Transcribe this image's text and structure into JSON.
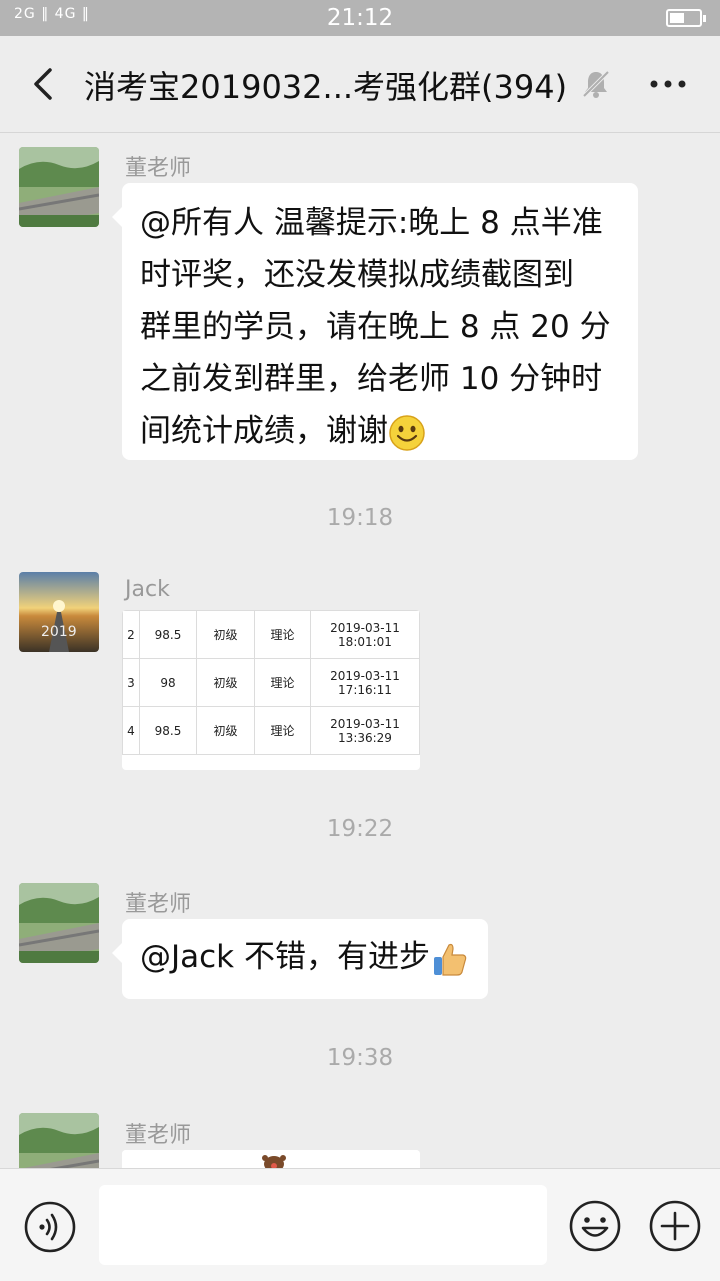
{
  "status": {
    "signal": "2G ‖ 4G ‖",
    "time": "21:12"
  },
  "header": {
    "title": "消考宝2019032...考强化群(394)"
  },
  "messages": [
    {
      "sender": "董老师",
      "text_lines": [
        "@所有人  温馨提示:晚上 8 点半准",
        "时评奖，还没发模拟成绩截图到",
        "群里的学员，请在晚上 8 点 20 分",
        "之前发到群里，给老师 10 分钟时",
        "间统计成绩，谢谢"
      ]
    },
    {
      "time": "19:18"
    },
    {
      "sender": "Jack",
      "table": [
        [
          "2",
          "98.5",
          "初级",
          "理论",
          "2019-03-11",
          "18:01:01"
        ],
        [
          "3",
          "98",
          "初级",
          "理论",
          "2019-03-11",
          "17:16:11"
        ],
        [
          "4",
          "98.5",
          "初级",
          "理论",
          "2019-03-11",
          "13:36:29"
        ]
      ]
    },
    {
      "time": "19:22"
    },
    {
      "sender": "董老师",
      "text": "@Jack  不错，有进步"
    },
    {
      "time": "19:38"
    },
    {
      "sender": "董老师"
    }
  ],
  "icons": [
    "back-icon",
    "mute-bell-icon",
    "more-icon",
    "voice-icon",
    "emoji-icon",
    "plus-icon",
    "smile-emoji",
    "thumbs-up-emoji"
  ]
}
